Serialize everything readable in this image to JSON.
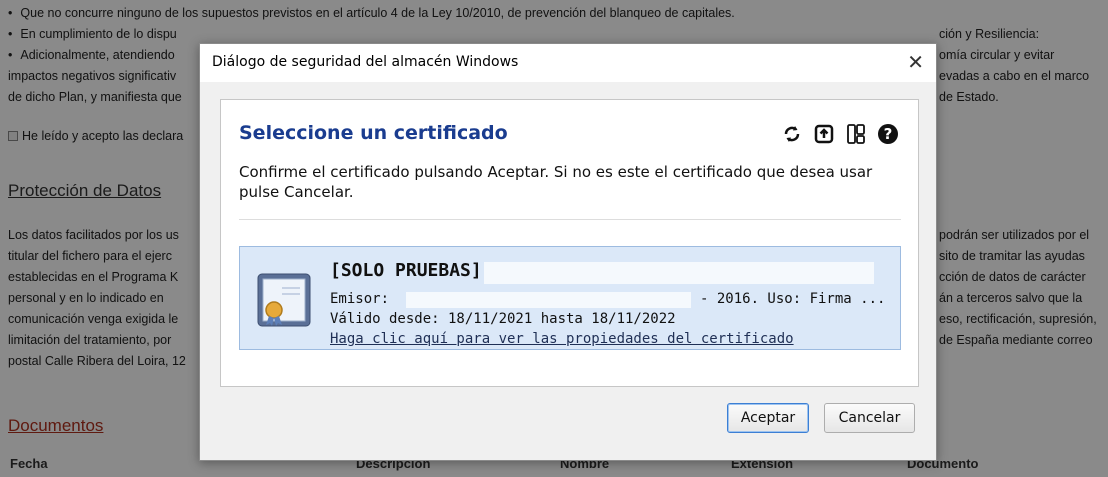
{
  "background": {
    "lines": [
      "Que no concurre ninguno de los supuestos previstos en el artículo 4 de la Ley 10/2010, de prevención del blanqueo de capitales.",
      "En cumplimiento de lo dispu",
      "Adicionalmente, atendiendo",
      "impactos negativos significativ",
      "de dicho Plan, y manifiesta que"
    ],
    "right_fragments": [
      "ción y Resiliencia:",
      "omía circular y evitar",
      "evadas a cabo en el marco",
      "de Estado."
    ],
    "checkbox_label": "He leído y acepto las declara",
    "protection_title": "Protección de Datos",
    "protection_left": [
      "Los datos facilitados por los us",
      "titular del fichero para el ejerc",
      "establecidas en el Programa K",
      "personal y en lo indicado en",
      "comunicación venga exigida le",
      "limitación del tratamiento, por",
      "postal Calle Ribera del Loira, 12"
    ],
    "protection_right": [
      "podrán ser utilizados por el",
      "sito de tramitar las ayudas",
      "cción de datos de carácter",
      "án a terceros salvo que la",
      "eso, rectificación, supresión,",
      "de España mediante correo"
    ],
    "documents_title": "Documentos",
    "table_headers": [
      "Fecha",
      "Descripción",
      "Nombre",
      "Extensión",
      "Documento"
    ]
  },
  "dialog": {
    "title": "Diálogo de seguridad del almacén Windows",
    "close_glyph": "✕",
    "heading": "Seleccione un certificado",
    "description": "Confirme el certificado pulsando Aceptar. Si no es este el certificado que desea usar pulse Cancelar.",
    "toolbar_icons": [
      "refresh-icon",
      "import-icon",
      "certificate-store-icon",
      "help-icon"
    ],
    "certificate": {
      "name": "[SOLO PRUEBAS]",
      "issuer_label": "Emisor:",
      "issuer_tail": "- 2016. Uso: Firma ...",
      "validity": "Válido desde: 18/11/2021 hasta 18/11/2022",
      "link": "Haga clic aquí para ver las propiedades del certificado"
    },
    "accept_label": "Aceptar",
    "cancel_label": "Cancelar"
  },
  "colors": {
    "heading": "#1a3c8f",
    "selection": "#dbe8f8",
    "documents_title": "#b0301f"
  }
}
